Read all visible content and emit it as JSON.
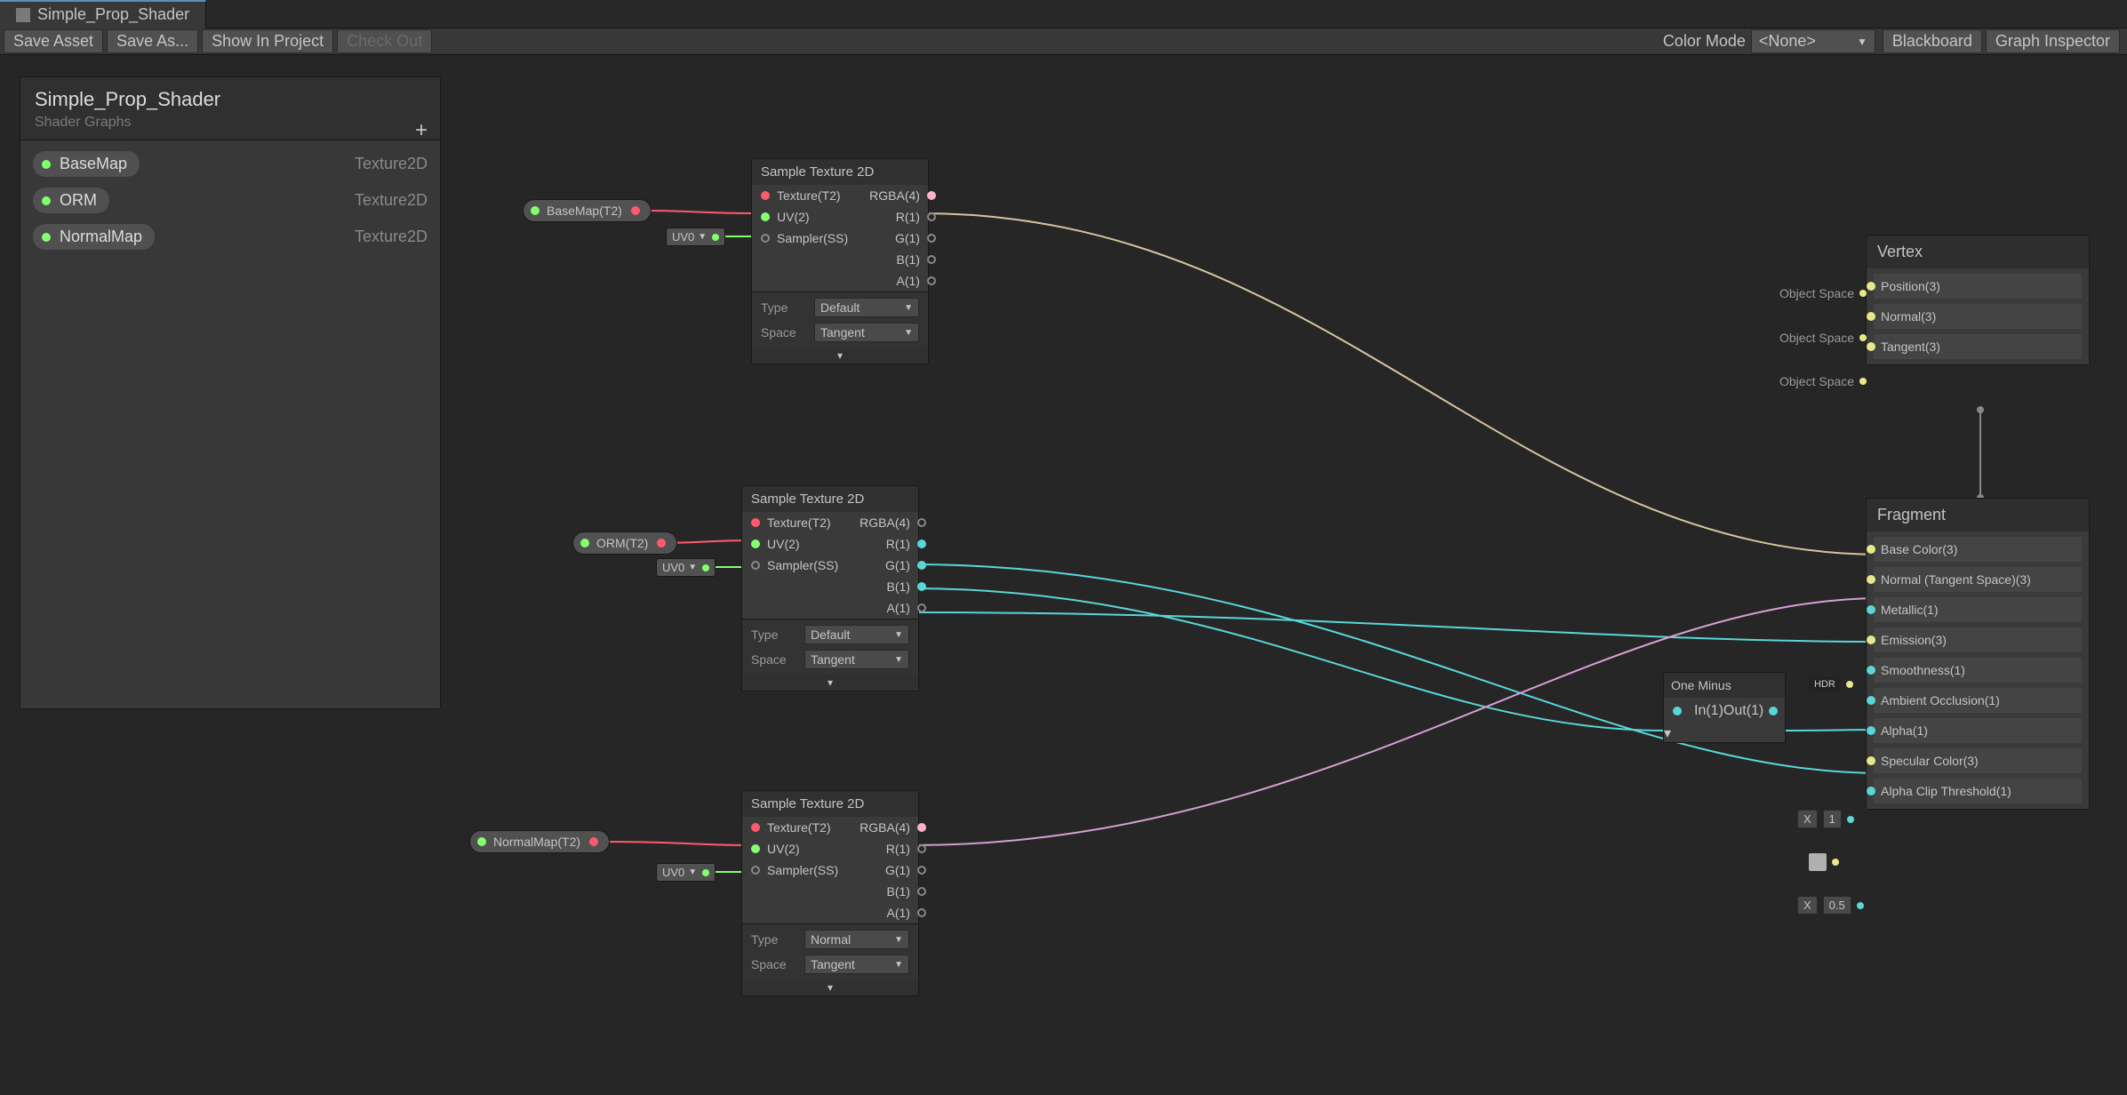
{
  "tab": {
    "title": "Simple_Prop_Shader"
  },
  "toolbar": {
    "save_asset": "Save Asset",
    "save_as": "Save As...",
    "show_in_project": "Show In Project",
    "check_out": "Check Out",
    "color_mode": "Color Mode",
    "color_mode_value": "<None>",
    "blackboard_btn": "Blackboard",
    "graph_inspector_btn": "Graph Inspector"
  },
  "blackboard": {
    "title": "Simple_Prop_Shader",
    "subtitle": "Shader Graphs",
    "items": [
      {
        "name": "BaseMap",
        "type": "Texture2D"
      },
      {
        "name": "ORM",
        "type": "Texture2D"
      },
      {
        "name": "NormalMap",
        "type": "Texture2D"
      }
    ]
  },
  "props": [
    {
      "label": "BaseMap(T2)"
    },
    {
      "label": "ORM(T2)"
    },
    {
      "label": "NormalMap(T2)"
    }
  ],
  "uv_tag": "UV0",
  "sample": {
    "title": "Sample Texture 2D",
    "in_tex": "Texture(T2)",
    "in_uv": "UV(2)",
    "in_sampler": "Sampler(SS)",
    "out_rgba": "RGBA(4)",
    "out_r": "R(1)",
    "out_g": "G(1)",
    "out_b": "B(1)",
    "out_a": "A(1)",
    "type_lbl": "Type",
    "space_lbl": "Space",
    "space_val": "Tangent",
    "type_default": "Default",
    "type_normal": "Normal"
  },
  "one_minus": {
    "title": "One Minus",
    "in": "In(1)",
    "out": "Out(1)"
  },
  "vertex": {
    "title": "Vertex",
    "pre": "Object Space",
    "rows": [
      {
        "label": "Position(3)"
      },
      {
        "label": "Normal(3)"
      },
      {
        "label": "Tangent(3)"
      }
    ]
  },
  "fragment": {
    "title": "Fragment",
    "rows": [
      {
        "label": "Base Color(3)"
      },
      {
        "label": "Normal (Tangent Space)(3)"
      },
      {
        "label": "Metallic(1)"
      },
      {
        "label": "Emission(3)"
      },
      {
        "label": "Smoothness(1)"
      },
      {
        "label": "Ambient Occlusion(1)"
      },
      {
        "label": "Alpha(1)"
      },
      {
        "label": "Specular Color(3)"
      },
      {
        "label": "Alpha Clip Threshold(1)"
      }
    ],
    "alpha_pre": {
      "x": "X",
      "val": "1"
    },
    "clip_pre": {
      "x": "X",
      "val": "0.5"
    },
    "hdr": "HDR"
  }
}
